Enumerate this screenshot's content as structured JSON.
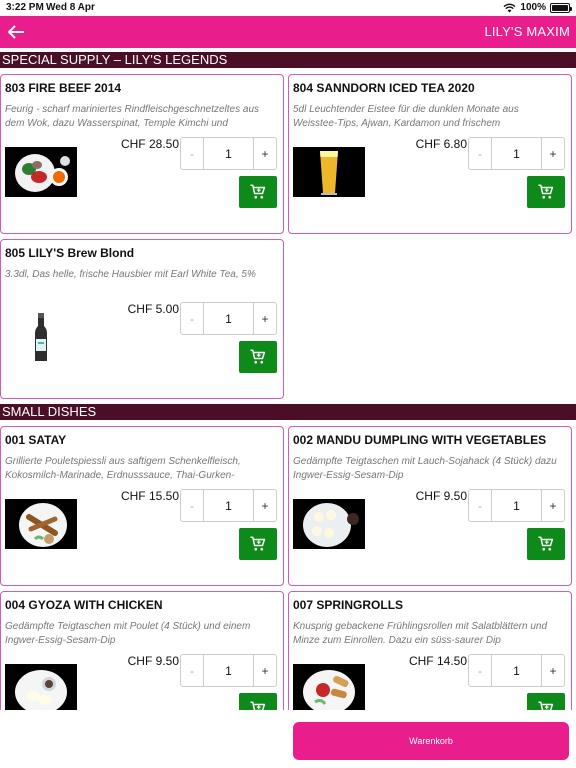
{
  "status": {
    "time": "3:22 PM",
    "date": "Wed 8 Apr",
    "battery": "100%"
  },
  "app_bar": {
    "title": "LILY'S MAXIM"
  },
  "sections": [
    {
      "title": "SPECIAL SUPPLY – LILY'S LEGENDS",
      "items": [
        {
          "name": "803 FIRE BEEF 2014",
          "desc": "Feurig - scharf mariniertes Rindfleischgeschnetzeltes aus dem Wok, dazu Wasserspinat, Temple Kimchi und",
          "price": "CHF 28.50",
          "qty": "1"
        },
        {
          "name": "804 SANNDORN ICED TEA 2020",
          "desc": "5dl Leuchtender Eistee für die dunklen Monate aus Weisstee-Tips, Ajwan, Kardamon und frischem",
          "price": "CHF 6.80",
          "qty": "1"
        },
        {
          "name": "805 LILY'S Brew Blond",
          "desc": "3.3dl, Das helle, frische Hausbier mit Earl White Tea, 5%",
          "price": "CHF 5.00",
          "qty": "1"
        }
      ]
    },
    {
      "title": "SMALL DISHES",
      "items": [
        {
          "name": "001 SATAY",
          "desc": "Grillierte Pouletspiessli aus saftigem Schenkelfleisch, Kokosmilch-Marinade, Erdnusssauce, Thai-Gurken-",
          "price": "CHF 15.50",
          "qty": "1"
        },
        {
          "name": "002 MANDU DUMPLING WITH VEGETABLES",
          "desc": "Gedämpfte Teigtaschen mit Lauch-Sojahack (4 Stück) dazu Ingwer-Essig-Sesam-Dip",
          "price": "CHF 9.50",
          "qty": "1"
        },
        {
          "name": "004 GYOZA WITH CHICKEN",
          "desc": "Gedämpfte Teigtaschen mit Poulet (4 Stück) und einem Ingwer-Essig-Sesam-Dip",
          "price": "CHF 9.50",
          "qty": "1"
        },
        {
          "name": "007 SPRINGROLLS",
          "desc": "Knusprig gebackene Frühlingsrollen mit Salatblättern und Minze zum Einrollen. Dazu ein süss-saurer Dip",
          "price": "CHF 14.50",
          "qty": "1"
        }
      ]
    }
  ],
  "stepper": {
    "minus": "-",
    "plus": "+"
  },
  "bottom": {
    "basket_label": "Warenkorb"
  },
  "icons": {
    "back": "arrow-left-icon",
    "cart": "cart-icon",
    "wifi": "wifi-icon",
    "battery": "battery-icon"
  },
  "colors": {
    "accent": "#e91e8c",
    "section": "#4a0f26",
    "add_to_cart": "#0d8a1a",
    "card_border": "#d35bb0"
  }
}
